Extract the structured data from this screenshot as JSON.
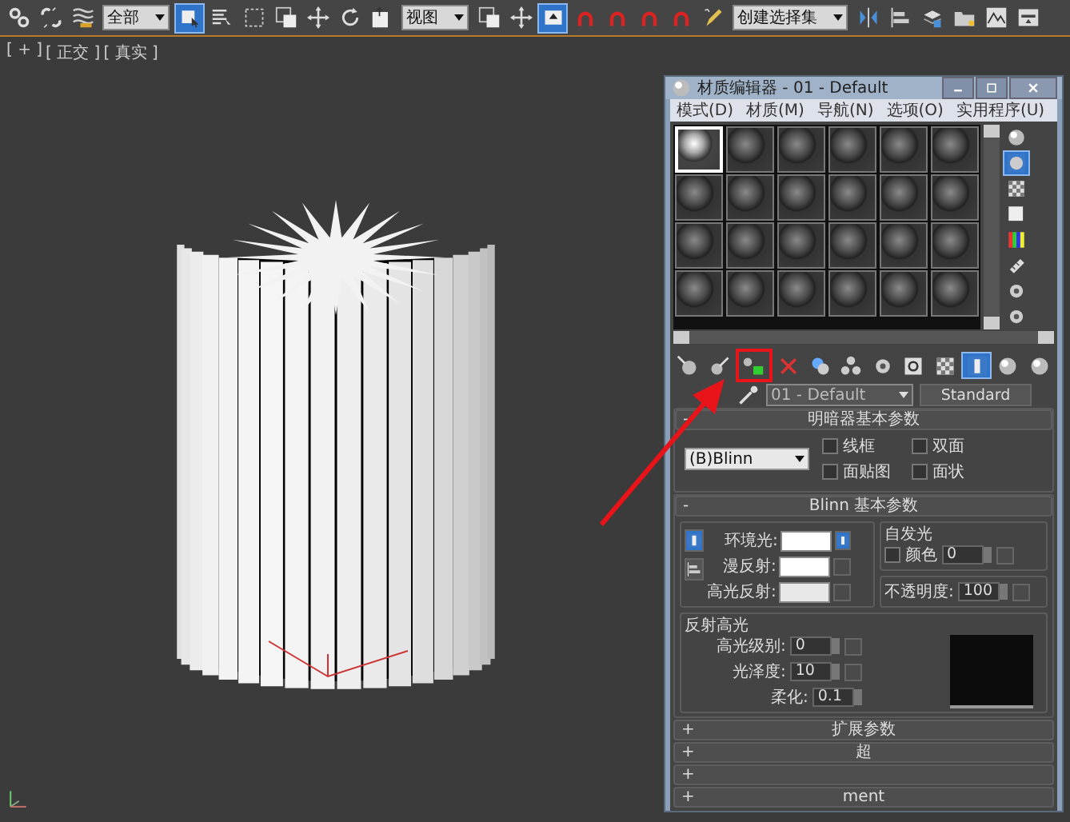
{
  "toolbar": [
    {
      "kind": "tool",
      "selected": false
    },
    {
      "kind": "tool",
      "selected": false
    },
    {
      "kind": "tool",
      "selected": false
    },
    {
      "kind": "dropdown",
      "value": "全部"
    },
    {
      "kind": "tool",
      "selected": true
    },
    {
      "kind": "tool",
      "selected": false
    },
    {
      "kind": "tool",
      "selected": false
    },
    {
      "kind": "tool",
      "selected": false
    },
    {
      "kind": "tool",
      "selected": false
    },
    {
      "kind": "tool",
      "selected": false
    },
    {
      "kind": "tool",
      "selected": false
    },
    {
      "kind": "dropdown",
      "value": "视图"
    },
    {
      "kind": "tool",
      "selected": false
    },
    {
      "kind": "tool",
      "selected": false
    },
    {
      "kind": "tool",
      "selected": true
    },
    {
      "kind": "tool",
      "selected": false
    },
    {
      "kind": "tool",
      "selected": false
    },
    {
      "kind": "tool",
      "selected": false
    },
    {
      "kind": "tool",
      "selected": false
    },
    {
      "kind": "tool",
      "selected": false
    },
    {
      "kind": "dropdown",
      "value": "创建选择集"
    },
    {
      "kind": "tool",
      "selected": false
    },
    {
      "kind": "tool",
      "selected": false
    },
    {
      "kind": "tool",
      "selected": false
    },
    {
      "kind": "tool",
      "selected": false
    },
    {
      "kind": "tool",
      "selected": false
    },
    {
      "kind": "tool",
      "selected": false
    }
  ],
  "viewport": {
    "labels": [
      "[ + ]",
      "[ 正交 ]",
      "[ 真实 ]"
    ]
  },
  "material_editor": {
    "title": "材质编辑器 - 01 - Default",
    "menu": [
      "模式(D)",
      "材质(M)",
      "导航(N)",
      "选项(O)",
      "实用程序(U)"
    ],
    "slots": [
      {
        "selected": true
      },
      {
        "selected": false
      },
      {
        "selected": false
      },
      {
        "selected": false
      },
      {
        "selected": false
      },
      {
        "selected": false
      },
      {
        "selected": false
      },
      {
        "selected": false
      },
      {
        "selected": false
      },
      {
        "selected": false
      },
      {
        "selected": false
      },
      {
        "selected": false
      },
      {
        "selected": false
      },
      {
        "selected": false
      },
      {
        "selected": false
      },
      {
        "selected": false
      },
      {
        "selected": false
      },
      {
        "selected": false
      },
      {
        "selected": false
      },
      {
        "selected": false
      },
      {
        "selected": false
      },
      {
        "selected": false
      },
      {
        "selected": false
      },
      {
        "selected": false
      }
    ],
    "side_tools": [
      {
        "selected": false
      },
      {
        "selected": true
      },
      {
        "selected": false
      },
      {
        "selected": false
      },
      {
        "selected": false
      },
      {
        "selected": false
      },
      {
        "selected": false
      },
      {
        "selected": false
      }
    ],
    "tools": [
      {
        "selected": false,
        "annotated": false
      },
      {
        "selected": false,
        "annotated": false
      },
      {
        "selected": false,
        "annotated": true
      },
      {
        "selected": false,
        "annotated": false
      },
      {
        "selected": false,
        "annotated": false
      },
      {
        "selected": false,
        "annotated": false
      },
      {
        "selected": false,
        "annotated": false
      },
      {
        "selected": false,
        "annotated": false
      },
      {
        "selected": false,
        "annotated": false
      },
      {
        "selected": true,
        "annotated": false
      },
      {
        "selected": false,
        "annotated": false
      },
      {
        "selected": false,
        "annotated": false
      }
    ],
    "material_name": "01 - Default",
    "material_type": "Standard",
    "shader_rollout": {
      "sign": "-",
      "title": "明暗器基本参数",
      "shader": "(B)Blinn",
      "options": [
        {
          "label": "线框",
          "checked": false
        },
        {
          "label": "双面",
          "checked": false
        },
        {
          "label": "面贴图",
          "checked": false
        },
        {
          "label": "面状",
          "checked": false
        }
      ]
    },
    "blinn_rollout": {
      "sign": "-",
      "title": "Blinn 基本参数",
      "colors": [
        {
          "label": "环境光:",
          "color": "#ffffff"
        },
        {
          "label": "漫反射:",
          "color": "#ffffff"
        },
        {
          "label": "高光反射:",
          "color": "#e8e8e8"
        }
      ],
      "self_illum": {
        "title": "自发光",
        "label": "颜色",
        "checked": false,
        "value": "0"
      },
      "opacity": {
        "label": "不透明度:",
        "value": "100"
      },
      "specular": {
        "title": "反射高光",
        "fields": [
          {
            "label": "高光级别:",
            "value": "0"
          },
          {
            "label": "光泽度:",
            "value": "10"
          },
          {
            "label": "柔化:",
            "value": "0.1"
          }
        ]
      }
    },
    "rollouts": [
      {
        "sign": "+",
        "title": "扩展参数"
      },
      {
        "sign": "+",
        "title": "超"
      },
      {
        "sign": "+"
      },
      {
        "sign": "+",
        "title": "ment"
      }
    ]
  }
}
